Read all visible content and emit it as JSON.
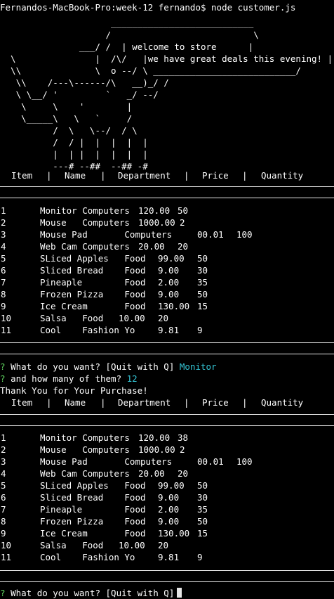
{
  "prompt_line": "Fernandos-MacBook-Pro:week-12 fernando$ node customer.js",
  "ascii_art": [
    "                     ___________________________",
    "                    /                           \\",
    "               ___/ /  | welcome to store      |",
    "  \\               |  /\\/   |we have great deals this evening! |",
    "  \\\\              \\  o --/ \\ ___________________________/",
    "   \\\\    /---\\------/\\   __)_/ /",
    "   \\ \\__/ '         `   _/ --/",
    "    \\     \\    '        |",
    "    \\_____\\   \\   `     /",
    "          /  \\   \\--/  / \\",
    "          /  / |  |  |  |  |",
    "          |  | |  |  |  |  |",
    "          ---# --##  --## -#"
  ],
  "headers": [
    "Item",
    "|",
    "Name",
    "|",
    "Department",
    "|",
    "Price",
    "|",
    "Quantity"
  ],
  "table1": [
    [
      "1",
      "Monitor Computers",
      "120.00",
      "50"
    ],
    [
      "2",
      "Mouse   Computers",
      "1000.00",
      "2"
    ],
    [
      "3",
      "Mouse Pad       Computers",
      "00.01",
      "100"
    ],
    [
      "4",
      "Web Cam Computers",
      "20.00",
      "20"
    ],
    [
      "5",
      "SLiced Apples   Food",
      "99.00",
      "50"
    ],
    [
      "6",
      "Sliced Bread    Food",
      "9.00",
      "30"
    ],
    [
      "7",
      "Pineaple        Food",
      "2.00",
      "35"
    ],
    [
      "8",
      "Frozen Pizza    Food",
      "9.00",
      "50"
    ],
    [
      "9",
      "Ice Cream       Food",
      "130.00",
      "15"
    ],
    [
      "10",
      "Salsa   Food",
      "10.00",
      "20"
    ],
    [
      "11",
      "Cool    Fashion Yo",
      "9.81",
      "9"
    ]
  ],
  "table2": [
    [
      "1",
      "Monitor Computers",
      "120.00",
      "38"
    ],
    [
      "2",
      "Mouse   Computers",
      "1000.00",
      "2"
    ],
    [
      "3",
      "Mouse Pad       Computers",
      "00.01",
      "100"
    ],
    [
      "4",
      "Web Cam Computers",
      "20.00",
      "20"
    ],
    [
      "5",
      "SLiced Apples   Food",
      "99.00",
      "50"
    ],
    [
      "6",
      "Sliced Bread    Food",
      "9.00",
      "30"
    ],
    [
      "7",
      "Pineaple        Food",
      "2.00",
      "35"
    ],
    [
      "8",
      "Frozen Pizza    Food",
      "9.00",
      "50"
    ],
    [
      "9",
      "Ice Cream       Food",
      "130.00",
      "15"
    ],
    [
      "10",
      "Salsa   Food",
      "10.00",
      "20"
    ],
    [
      "11",
      "Cool    Fashion Yo",
      "9.81",
      "9"
    ]
  ],
  "qmark": "?",
  "question1": "What do you want? [Quit with Q]",
  "answer1": "Monitor",
  "question2": "and how many of them?",
  "answer2": "12",
  "thanks": "Thank You for Your Purchase!",
  "question3": "What do you want? [Quit with Q]",
  "colors": {
    "background": "#000000",
    "text": "#ffffff",
    "prompt_mark": "#5fd35f",
    "answer": "#35c6d6"
  }
}
